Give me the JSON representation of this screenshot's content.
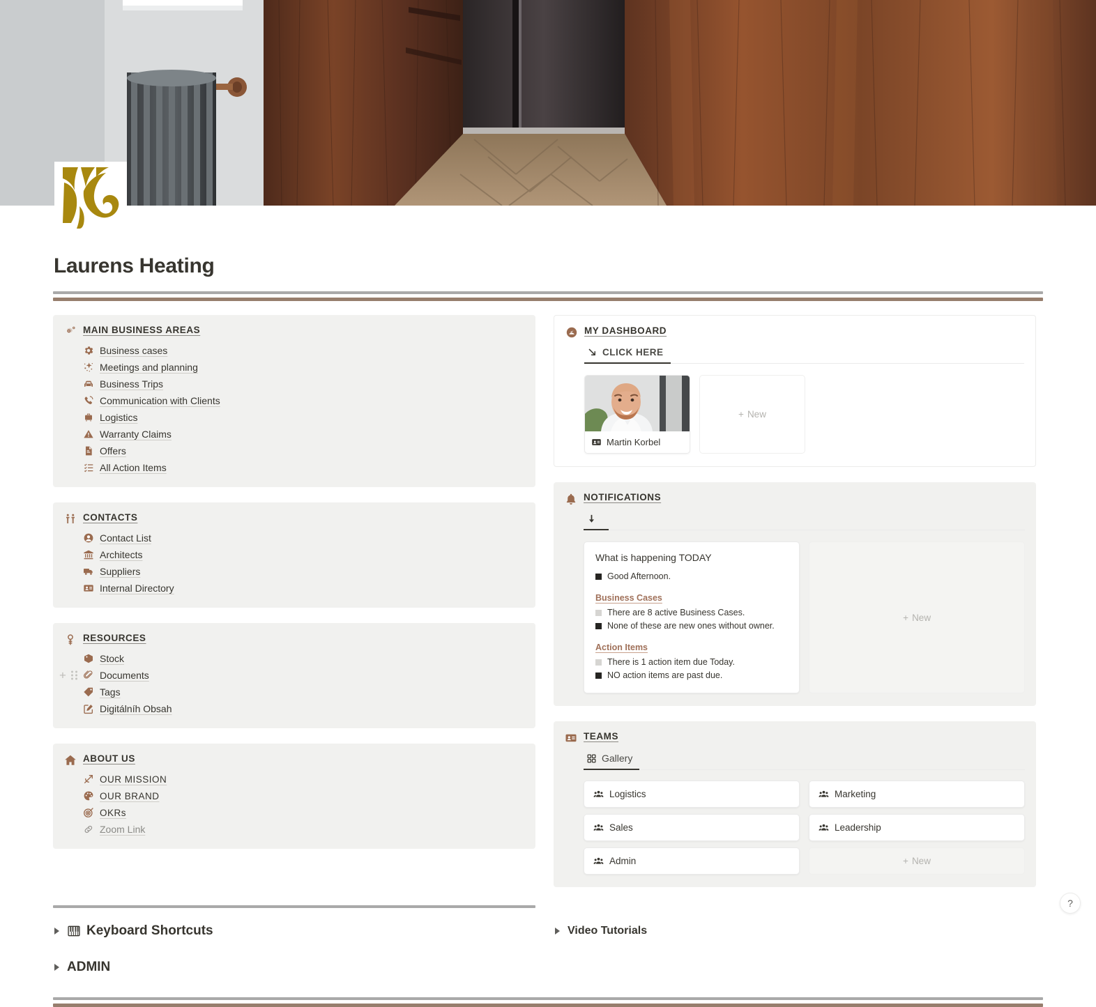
{
  "cover": {
    "alt": "interior-corridor-dark-wood-paneling-radiator-herringbone-floor"
  },
  "page": {
    "icon_name": "gold-ornamental-swirl-logo",
    "title": "Laurens Heating"
  },
  "left_column": {
    "sections": [
      {
        "title": "MAIN BUSINESS AREAS",
        "icon": "gears-icon",
        "items": [
          {
            "label": "Business cases",
            "icon": "gear-icon"
          },
          {
            "label": "Meetings and planning",
            "icon": "sparkles-icon"
          },
          {
            "label": "Business Trips",
            "icon": "car-icon"
          },
          {
            "label": "Communication with Clients",
            "icon": "phone-call-icon"
          },
          {
            "label": "Logistics",
            "icon": "luggage-icon"
          },
          {
            "label": "Warranty Claims",
            "icon": "warning-triangle-icon"
          },
          {
            "label": "Offers",
            "icon": "document-icon"
          },
          {
            "label": "All Action Items",
            "icon": "checklist-icon"
          }
        ]
      },
      {
        "title": "CONTACTS",
        "icon": "two-people-icon",
        "items": [
          {
            "label": "Contact List",
            "icon": "person-circle-icon"
          },
          {
            "label": "Architects",
            "icon": "bank-building-icon"
          },
          {
            "label": "Suppliers",
            "icon": "truck-icon"
          },
          {
            "label": "Internal Directory",
            "icon": "id-card-icon"
          }
        ]
      },
      {
        "title": "RESOURCES",
        "icon": "key-icon",
        "items": [
          {
            "label": "Stock",
            "icon": "package-icon"
          },
          {
            "label": "Documents",
            "icon": "paperclip-icon",
            "handles": true
          },
          {
            "label": "Tags",
            "icon": "tag-icon"
          },
          {
            "label": "Digitálníh Obsah",
            "icon": "edit-square-icon"
          }
        ]
      },
      {
        "title": "ABOUT US",
        "icon": "house-icon",
        "items": [
          {
            "label": "OUR MISSION",
            "icon": "bow-arrow-icon",
            "caps": true
          },
          {
            "label": "OUR BRAND",
            "icon": "palette-icon",
            "caps": true
          },
          {
            "label": "OKRs",
            "icon": "target-icon",
            "caps": true
          },
          {
            "label": "Zoom Link",
            "icon": "link-icon",
            "muted": true
          }
        ]
      }
    ]
  },
  "right_column": {
    "dashboard": {
      "title": "MY DASHBOARD",
      "icon": "dashboard-gauge-icon",
      "tab": {
        "label": "CLICK HERE",
        "icon": "arrow-down-right-icon"
      },
      "cards": [
        {
          "name": "Martin Korbel",
          "icon": "id-card-icon",
          "image": "portrait-bearded-man-white-shirt"
        }
      ],
      "new_label": "New"
    },
    "notifications": {
      "title": "NOTIFICATIONS",
      "icon": "bell-icon",
      "tab": {
        "label": "",
        "icon": "arrow-down-icon"
      },
      "card": {
        "title": "What is happening TODAY",
        "greeting": {
          "text": "Good Afternoon.",
          "marker": "dark"
        },
        "groups": [
          {
            "heading": "Business Cases",
            "lines": [
              {
                "text": "There are 8 active Business Cases.",
                "marker": "light"
              },
              {
                "text": "None of these are new ones without owner.",
                "marker": "dark"
              }
            ]
          },
          {
            "heading": "Action Items",
            "lines": [
              {
                "text": "There is 1 action item due Today.",
                "marker": "light"
              },
              {
                "text": "NO action items are past due.",
                "marker": "dark"
              }
            ]
          }
        ]
      },
      "new_label": "New"
    },
    "teams": {
      "title": "TEAMS",
      "icon": "id-card-icon",
      "tab": {
        "label": "Gallery",
        "icon": "gallery-grid-icon"
      },
      "items": [
        {
          "label": "Logistics",
          "icon": "people-group-icon"
        },
        {
          "label": "Marketing",
          "icon": "people-group-icon"
        },
        {
          "label": "Sales",
          "icon": "people-group-icon"
        },
        {
          "label": "Leadership",
          "icon": "people-group-icon"
        },
        {
          "label": "Admin",
          "icon": "people-group-icon"
        }
      ],
      "new_label": "New"
    },
    "video_tutorials": {
      "label": "Video Tutorials"
    }
  },
  "toggles": {
    "keyboard_shortcuts": {
      "label": "Keyboard Shortcuts",
      "icon": "piano-keyboard-icon"
    },
    "admin": {
      "label": "ADMIN"
    }
  },
  "help": {
    "label": "?"
  },
  "colors": {
    "accent_brown": "#9a6b4f",
    "rule_gray": "#a9a9a9",
    "rule_brown": "#977e6d",
    "panel_bg": "#f1f1ef",
    "logo_gold": "#a8880f"
  }
}
